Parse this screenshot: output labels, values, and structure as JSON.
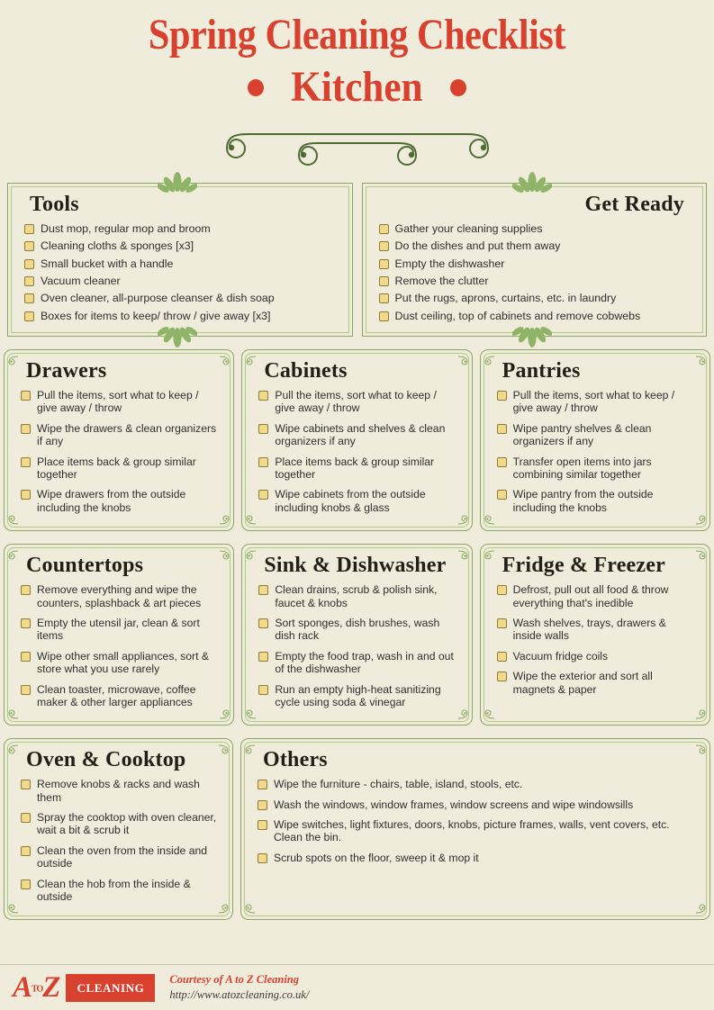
{
  "header": {
    "title": "Spring Cleaning Checklist",
    "subtitle": "Kitchen"
  },
  "colors": {
    "background": "#efecdb",
    "accent_red": "#d9412f",
    "border_green": "#8aa85f",
    "border_green_light": "#b3c98c",
    "checkbox_fill": "#f2d98a",
    "checkbox_border": "#8d7b3c",
    "text": "#2f2f2f",
    "heading": "#241f16"
  },
  "sections": {
    "tools": {
      "title": "Tools",
      "align": "left",
      "items": [
        "Dust mop, regular mop and broom",
        "Cleaning cloths & sponges [x3]",
        "Small bucket with a handle",
        "Vacuum cleaner",
        "Oven cleaner, all-purpose cleanser & dish soap",
        "Boxes for items to keep/ throw / give away [x3]"
      ]
    },
    "get_ready": {
      "title": "Get Ready",
      "align": "right",
      "items": [
        "Gather your cleaning supplies",
        "Do the dishes and put them away",
        "Empty the dishwasher",
        "Remove the clutter",
        "Put the rugs, aprons, curtains, etc.  in laundry",
        "Dust ceiling, top of cabinets and remove cobwebs"
      ]
    },
    "drawers": {
      "title": "Drawers",
      "items": [
        "Pull the items, sort what to keep / give away / throw",
        "Wipe the drawers & clean organizers if any",
        "Place items back & group similar together",
        "Wipe drawers from the outside including the knobs"
      ]
    },
    "cabinets": {
      "title": "Cabinets",
      "items": [
        "Pull the items, sort what to keep / give away / throw",
        "Wipe cabinets and shelves & clean organizers if any",
        "Place items back & group similar together",
        "Wipe cabinets from the outside including knobs & glass"
      ]
    },
    "pantries": {
      "title": "Pantries",
      "items": [
        "Pull the items, sort what to keep / give away / throw",
        "Wipe pantry shelves & clean organizers if any",
        "Transfer open items into jars combining similar together",
        "Wipe pantry from the outside including the knobs"
      ]
    },
    "countertops": {
      "title": "Countertops",
      "items": [
        "Remove everything and wipe the counters, splashback & art pieces",
        "Empty the utensil jar, clean & sort items",
        "Wipe other small appliances, sort & store what you use rarely",
        "Clean toaster, microwave, coffee maker & other larger appliances"
      ]
    },
    "sink_dishwasher": {
      "title": "Sink & Dishwasher",
      "items": [
        "Clean drains, scrub & polish sink, faucet & knobs",
        "Sort sponges, dish brushes, wash dish rack",
        "Empty the food trap, wash in and out of the dishwasher",
        "Run an empty high-heat sanitizing cycle using soda & vinegar"
      ]
    },
    "fridge_freezer": {
      "title": "Fridge & Freezer",
      "items": [
        "Defrost, pull out all food & throw everything that's inedible",
        "Wash shelves, trays, drawers & inside walls",
        "Vacuum fridge coils",
        "Wipe the exterior and sort all magnets & paper"
      ]
    },
    "oven_cooktop": {
      "title": "Oven & Cooktop",
      "items": [
        "Remove knobs & racks and wash them",
        "Spray the cooktop with oven cleaner, wait a bit & scrub it",
        "Clean the oven from the inside and outside",
        "Clean the hob from the inside & outside"
      ]
    },
    "others": {
      "title": "Others",
      "items": [
        "Wipe the furniture - chairs, table, island, stools, etc.",
        "Wash the windows, window frames, window screens and wipe windowsills",
        "Wipe switches, light fixtures, doors, knobs, picture frames, walls, vent covers, etc. Clean the bin.",
        "Scrub spots on the floor, sweep it & mop it"
      ]
    }
  },
  "footer": {
    "logo_a": "A",
    "logo_to": "TO",
    "logo_z": "Z",
    "logo_badge": "CLEANING",
    "credit_line1": "Courtesy of A to Z Cleaning",
    "credit_line2": "http://www.atozcleaning.co.uk/"
  }
}
